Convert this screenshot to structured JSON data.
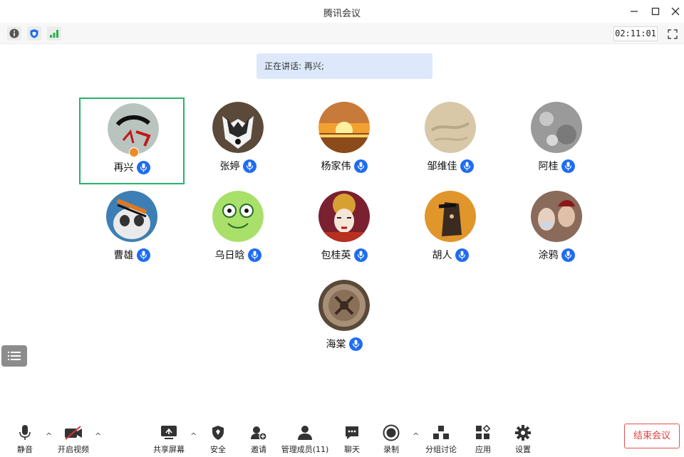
{
  "window": {
    "title": "腾讯会议",
    "controls": [
      "minimize-icon",
      "maximize-icon",
      "close-icon"
    ]
  },
  "infobar": {
    "icons": [
      "info-icon",
      "shield-icon",
      "signal-icon"
    ],
    "timer": "02:11:01",
    "fullscreen_icon": "fullscreen-icon"
  },
  "speaking": {
    "label": "正在讲话: 再兴;"
  },
  "participants": [
    {
      "name": "再兴",
      "host": true,
      "active": true,
      "avatar_color": "#b9c4bf"
    },
    {
      "name": "张婷",
      "host": false,
      "active": false,
      "avatar_color": "#5b4a3a"
    },
    {
      "name": "杨家伟",
      "host": false,
      "active": false,
      "avatar_color": "#f2a030"
    },
    {
      "name": "邹维佳",
      "host": false,
      "active": false,
      "avatar_color": "#d8c8a8"
    },
    {
      "name": "阿桂",
      "host": false,
      "active": false,
      "avatar_color": "#9a9a9a"
    },
    {
      "name": "曹雄",
      "host": false,
      "active": false,
      "avatar_color": "#3d7fb5"
    },
    {
      "name": "乌日晗",
      "host": false,
      "active": false,
      "avatar_color": "#a8e06a"
    },
    {
      "name": "包桂英",
      "host": false,
      "active": false,
      "avatar_color": "#7a2030"
    },
    {
      "name": "胡人",
      "host": false,
      "active": false,
      "avatar_color": "#e0962a"
    },
    {
      "name": "涂鸦",
      "host": false,
      "active": false,
      "avatar_color": "#8a6a5a"
    },
    {
      "name": "海棠",
      "host": false,
      "active": false,
      "avatar_color": "#8a7058"
    }
  ],
  "toolbar": {
    "mute": "静音",
    "video": "开启视频",
    "share": "共享屏幕",
    "security": "安全",
    "invite": "邀请",
    "members": "管理成员(11)",
    "chat": "聊天",
    "record": "录制",
    "breakout": "分组讨论",
    "apps": "应用",
    "settings": "设置",
    "end": "结束会议"
  },
  "colors": {
    "accent": "#1e6cf0",
    "active_border": "#27b36a",
    "end_red": "#e04040",
    "banner_bg": "#dde9fb"
  }
}
